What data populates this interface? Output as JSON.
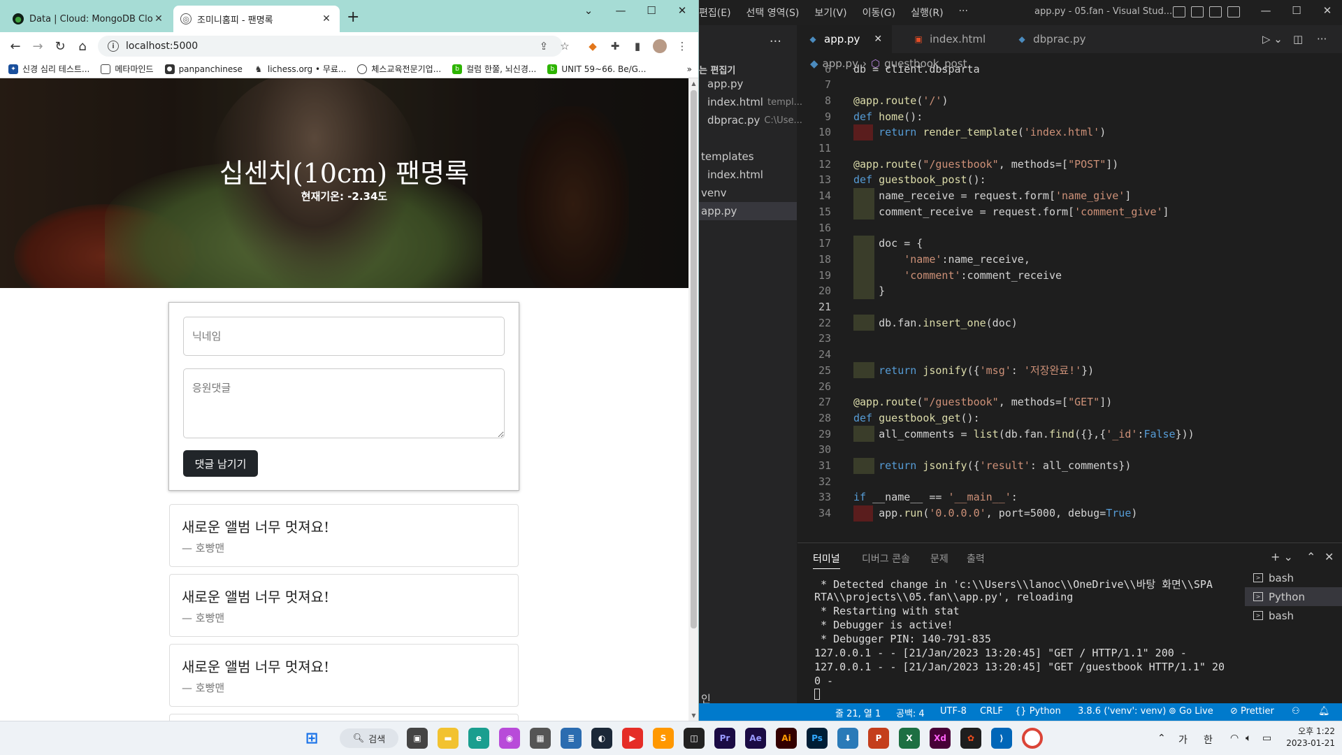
{
  "browser": {
    "tabs": [
      {
        "label": "Data | Cloud: MongoDB Cloud",
        "active": false
      },
      {
        "label": "조미니홈피 - 팬명록",
        "active": true
      }
    ],
    "url": "localhost:5000",
    "bookmarks": [
      "신경 심리 테스트...",
      "메타마인드",
      "panpanchinese",
      "lichess.org • 무료...",
      "체스교육전문기업...",
      "컬럼 한쭐, 뇌신경...",
      "UNIT 59~66. Be/G..."
    ]
  },
  "page": {
    "title": "십센치(10cm) 팬명록",
    "temperature": "현재기온: -2.34도",
    "form": {
      "nickname_placeholder": "닉네임",
      "comment_placeholder": "응원댓글",
      "submit_label": "댓글 남기기"
    },
    "comments": [
      {
        "text": "새로운 앨범 너무 멋져요!",
        "author": "— 호빵맨"
      },
      {
        "text": "새로운 앨범 너무 멋져요!",
        "author": "— 호빵맨"
      },
      {
        "text": "새로운 앨범 너무 멋져요!",
        "author": "— 호빵맨"
      }
    ]
  },
  "vscode": {
    "menu": [
      "편집(E)",
      "선택 영역(S)",
      "보기(V)",
      "이동(G)",
      "실행(R)",
      "···"
    ],
    "window_title": "app.py - 05.fan - Visual Stud...",
    "sidebar": {
      "open_editors_label": "는 편집기",
      "open_editors": [
        {
          "name": "app.py",
          "path": ""
        },
        {
          "name": "index.html",
          "path": "templ..."
        },
        {
          "name": "dbprac.py",
          "path": "C:\\Use..."
        }
      ],
      "tree": [
        "templates",
        "index.html",
        "venv",
        "app.py"
      ],
      "bottom_label": "인"
    },
    "tabs": [
      "app.py",
      "index.html",
      "dbprac.py"
    ],
    "breadcrumb": [
      "app.py",
      "guestbook_post"
    ],
    "code": [
      {
        "n": "6",
        "text": "db = client.dbsparta"
      },
      {
        "n": "7",
        "text": ""
      },
      {
        "n": "8",
        "text": "@app.route('/')"
      },
      {
        "n": "9",
        "text": "def home():"
      },
      {
        "n": "10",
        "text": "    return render_template('index.html')"
      },
      {
        "n": "11",
        "text": ""
      },
      {
        "n": "12",
        "text": "@app.route(\"/guestbook\", methods=[\"POST\"])"
      },
      {
        "n": "13",
        "text": "def guestbook_post():"
      },
      {
        "n": "14",
        "text": "    name_receive = request.form['name_give']"
      },
      {
        "n": "15",
        "text": "    comment_receive = request.form['comment_give']"
      },
      {
        "n": "16",
        "text": ""
      },
      {
        "n": "17",
        "text": "    doc = {"
      },
      {
        "n": "18",
        "text": "        'name':name_receive,"
      },
      {
        "n": "19",
        "text": "        'comment':comment_receive"
      },
      {
        "n": "20",
        "text": "    }"
      },
      {
        "n": "21",
        "text": ""
      },
      {
        "n": "22",
        "text": "    db.fan.insert_one(doc)"
      },
      {
        "n": "23",
        "text": ""
      },
      {
        "n": "24",
        "text": ""
      },
      {
        "n": "25",
        "text": "    return jsonify({'msg': '저장완료!'})"
      },
      {
        "n": "26",
        "text": ""
      },
      {
        "n": "27",
        "text": "@app.route(\"/guestbook\", methods=[\"GET\"])"
      },
      {
        "n": "28",
        "text": "def guestbook_get():"
      },
      {
        "n": "29",
        "text": "    all_comments = list(db.fan.find({},{'_id':False}))"
      },
      {
        "n": "30",
        "text": ""
      },
      {
        "n": "31",
        "text": "    return jsonify({'result': all_comments})"
      },
      {
        "n": "32",
        "text": ""
      },
      {
        "n": "33",
        "text": "if __name__ == '__main__':"
      },
      {
        "n": "34",
        "text": "    app.run('0.0.0.0', port=5000, debug=True)"
      }
    ],
    "panel_tabs": [
      "터미널",
      "디버그 콘솔",
      "문제",
      "출력"
    ],
    "terminal": [
      " * Detected change in 'c:\\\\Users\\\\lanoc\\\\OneDrive\\\\바탕 화면\\\\SPA",
      "RTA\\\\projects\\\\05.fan\\\\app.py', reloading",
      " * Restarting with stat",
      " * Debugger is active!",
      " * Debugger PIN: 140-791-835",
      "127.0.0.1 - - [21/Jan/2023 13:20:45] \"GET / HTTP/1.1\" 200 -",
      "127.0.0.1 - - [21/Jan/2023 13:20:45] \"GET /guestbook HTTP/1.1\" 20",
      "0 -"
    ],
    "terminal_list": [
      "bash",
      "Python",
      "bash"
    ],
    "status": {
      "position": "줄 21, 열 1",
      "spaces": "공백: 4",
      "encoding": "UTF-8",
      "eol": "CRLF",
      "language": "Python",
      "interpreter": "3.8.6 ('venv': venv)",
      "golive": "Go Live",
      "prettier": "Prettier"
    }
  },
  "taskbar": {
    "search_label": "검색",
    "ime": [
      "가",
      "한"
    ],
    "time": "오후 1:22",
    "date": "2023-01-21"
  },
  "colors": {
    "chrome_frame": "#a6dcd5",
    "vscode_status": "#007acc",
    "button_dark": "#212529"
  }
}
